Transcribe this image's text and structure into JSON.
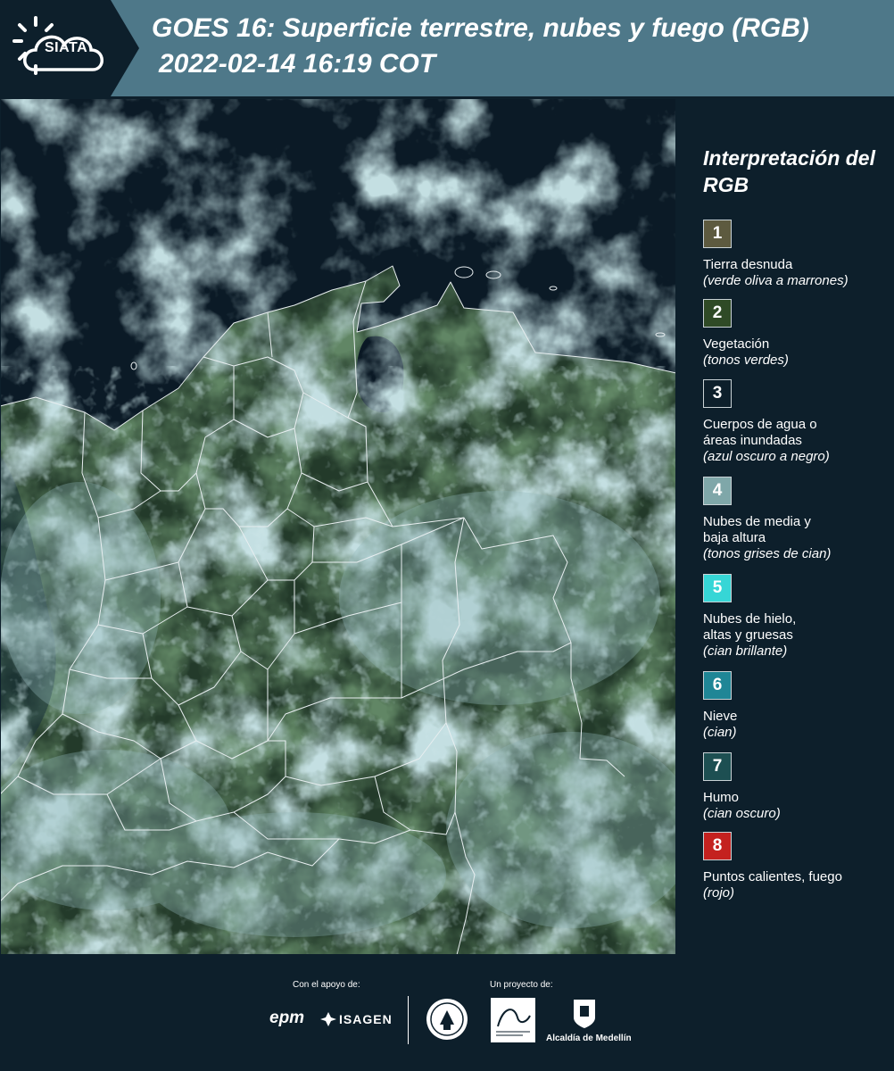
{
  "header": {
    "title": "GOES 16: Superficie terrestre, nubes y fuego (RGB)",
    "subtitle": "2022-02-14 16:19 COT",
    "logo_text": "SIATA",
    "bg_color": "#4e7889",
    "logo_bg_color": "#0d1f2b"
  },
  "legend": {
    "title": "Interpretación del RGB",
    "items": [
      {
        "number": "1",
        "label": "Tierra desnuda",
        "note": "(verde oliva a marrones)",
        "color": "#5d5a3f"
      },
      {
        "number": "2",
        "label": "Vegetación",
        "note": "(tonos verdes)",
        "color": "#2f4a26"
      },
      {
        "number": "3",
        "label": "Cuerpos de agua o áreas inundadas",
        "note": "(azul oscuro a negro)",
        "color": "#0d1f2b"
      },
      {
        "number": "4",
        "label": "Nubes de media y baja altura",
        "note": "(tonos grises de cian)",
        "color": "#7fa7a9"
      },
      {
        "number": "5",
        "label": "Nubes de hielo, altas y gruesas",
        "note": "(cian brillante)",
        "color": "#36d6d6"
      },
      {
        "number": "6",
        "label": "Nieve",
        "note": "(cian)",
        "color": "#1f8696"
      },
      {
        "number": "7",
        "label": "Humo",
        "note": "(cian oscuro)",
        "color": "#1d4f52"
      },
      {
        "number": "8",
        "label": "Puntos calientes, fuego",
        "note": "(rojo)",
        "color": "#c4211f"
      }
    ]
  },
  "footer": {
    "support_caption": "Con el apoyo de:",
    "project_caption": "Un proyecto de:",
    "sponsor_1": "epm",
    "sponsor_2": "ISAGEN",
    "partner_alcaldia": "Alcaldía de Medellín"
  }
}
